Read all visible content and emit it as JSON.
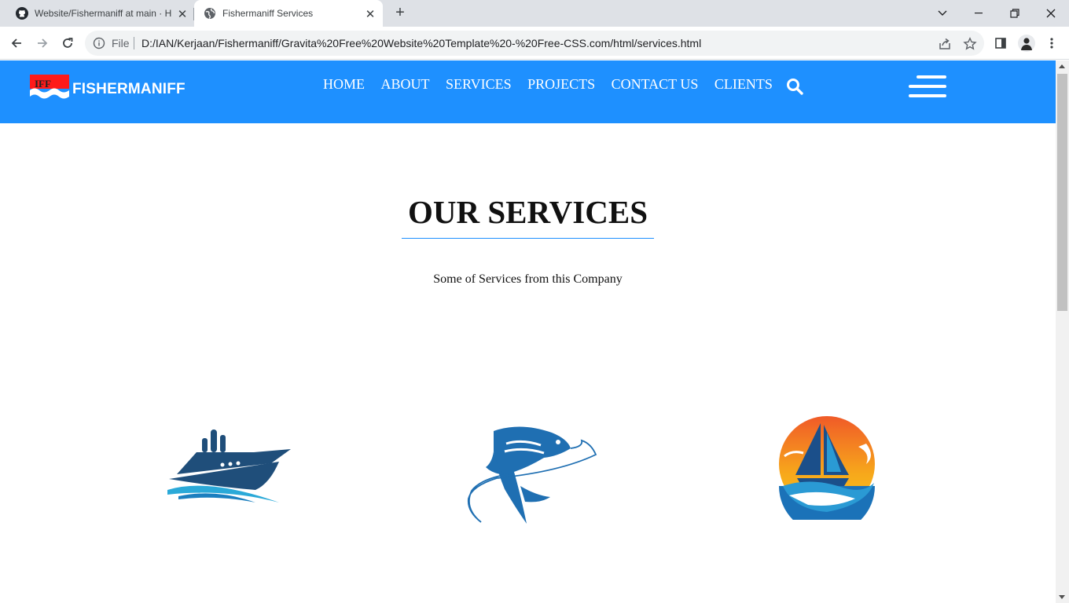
{
  "browser": {
    "tabs": [
      {
        "title": "Website/Fishermaniff at main · H",
        "close": "✕"
      },
      {
        "title": "Fishermaniff Services",
        "close": "✕"
      }
    ],
    "new_tab": "+",
    "address": {
      "scheme_label": "File",
      "url": "D:/IAN/Kerjaan/Fishermaniff/Gravita%20Free%20Website%20Template%20-%20Free-CSS.com/html/services.html"
    }
  },
  "site": {
    "brand": "FISHERMANIFF",
    "logo_mark_text": "IFF",
    "nav": [
      "HOME",
      "ABOUT",
      "SERVICES",
      "PROJECTS",
      "CONTACT US",
      "CLIENTS"
    ],
    "accent": "#1e90ff"
  },
  "services": {
    "title": "OUR SERVICES",
    "subtitle": "Some of Services from this Company",
    "items": [
      {
        "icon": "cruise-ship-icon"
      },
      {
        "icon": "fish-icon"
      },
      {
        "icon": "sailboat-sunset-icon"
      }
    ]
  }
}
